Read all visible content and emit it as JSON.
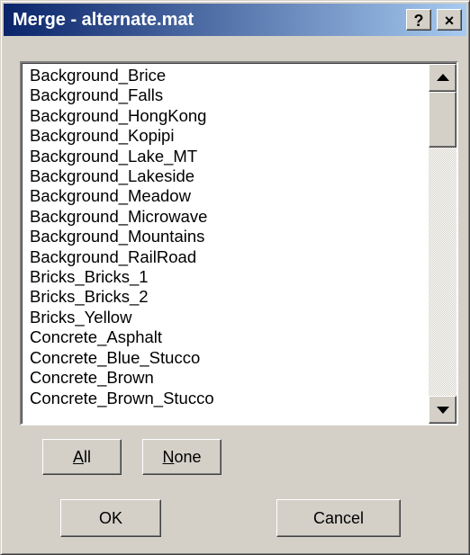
{
  "window": {
    "title": "Merge - alternate.mat",
    "help_glyph": "?",
    "close_glyph": "×"
  },
  "list": {
    "items": [
      "Background_Brice",
      "Background_Falls",
      "Background_HongKong",
      "Background_Kopipi",
      "Background_Lake_MT",
      "Background_Lakeside",
      "Background_Meadow",
      "Background_Microwave",
      "Background_Mountains",
      "Background_RailRoad",
      "Bricks_Bricks_1",
      "Bricks_Bricks_2",
      "Bricks_Yellow",
      "Concrete_Asphalt",
      "Concrete_Blue_Stucco",
      "Concrete_Brown",
      "Concrete_Brown_Stucco"
    ]
  },
  "buttons": {
    "all_mnemonic": "A",
    "all_rest": "ll",
    "none_mnemonic": "N",
    "none_rest": "one",
    "ok": "OK",
    "cancel": "Cancel"
  },
  "colors": {
    "titlebar_start": "#0a246a",
    "titlebar_end": "#a6caf0",
    "face": "#d4d0c8"
  }
}
